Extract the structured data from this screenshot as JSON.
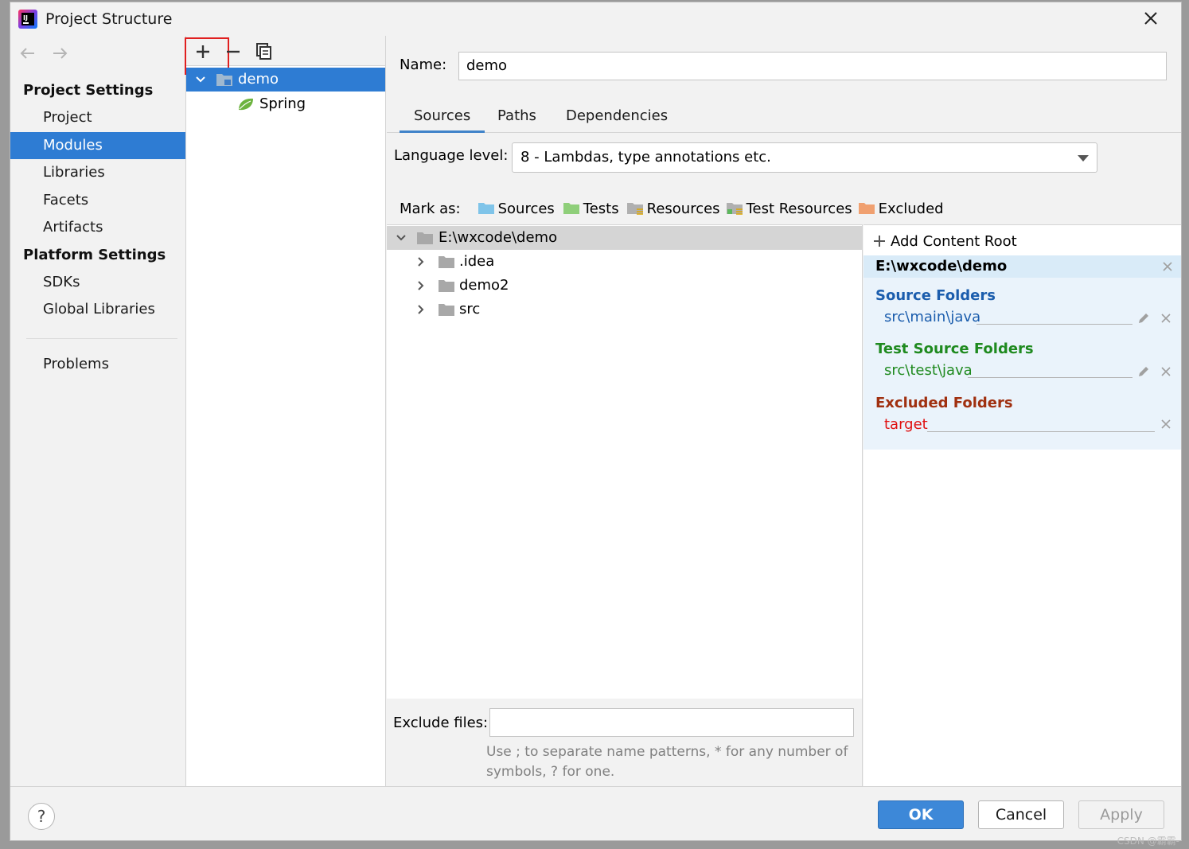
{
  "window": {
    "title": "Project Structure"
  },
  "left_nav": {
    "section_project": "Project Settings",
    "project_items": [
      "Project",
      "Modules",
      "Libraries",
      "Facets",
      "Artifacts"
    ],
    "section_platform": "Platform Settings",
    "platform_items": [
      "SDKs",
      "Global Libraries"
    ],
    "problems": "Problems",
    "selected": "Modules"
  },
  "modules": {
    "toolbar": [
      "add-icon",
      "remove-icon",
      "copy-icon"
    ],
    "tree": [
      {
        "label": "demo",
        "selected": true
      },
      {
        "label": "Spring",
        "selected": false
      }
    ]
  },
  "main": {
    "name_label": "Name:",
    "name_value": "demo",
    "tabs": [
      "Sources",
      "Paths",
      "Dependencies"
    ],
    "active_tab": "Sources",
    "language_label": "Language level:",
    "language_value": "8 - Lambdas, type annotations etc.",
    "mark_as_label": "Mark as:",
    "mark_as": [
      {
        "label": "Sources",
        "color": "#7fc4e9"
      },
      {
        "label": "Tests",
        "color": "#8fcf7a"
      },
      {
        "label": "Resources",
        "color": "#b0b0b0"
      },
      {
        "label": "Test Resources",
        "color": "#b0b0b0"
      },
      {
        "label": "Excluded",
        "color": "#f0a070"
      }
    ],
    "content_tree": {
      "root": "E:\\wxcode\\demo",
      "children": [
        ".idea",
        "demo2",
        "src"
      ]
    },
    "exclude_label": "Exclude files:",
    "exclude_value": "",
    "exclude_hint_1": "Use ; to separate name patterns, * for any number of",
    "exclude_hint_2": "symbols, ? for one."
  },
  "roots_panel": {
    "add_label": "Add Content Root",
    "root_path": "E:\\wxcode\\demo",
    "source_title": "Source Folders",
    "source_item": "src\\main\\java",
    "test_title": "Test Source Folders",
    "test_item": "src\\test\\java",
    "excluded_title": "Excluded Folders",
    "excluded_item": "target",
    "colors": {
      "source": "#1b5dad",
      "test": "#1f8a1f",
      "excluded_title": "#a03010",
      "excluded_item": "#e01010"
    }
  },
  "buttons": {
    "help": "?",
    "ok": "OK",
    "cancel": "Cancel",
    "apply": "Apply"
  },
  "watermark": "CSDN @霸霸-"
}
